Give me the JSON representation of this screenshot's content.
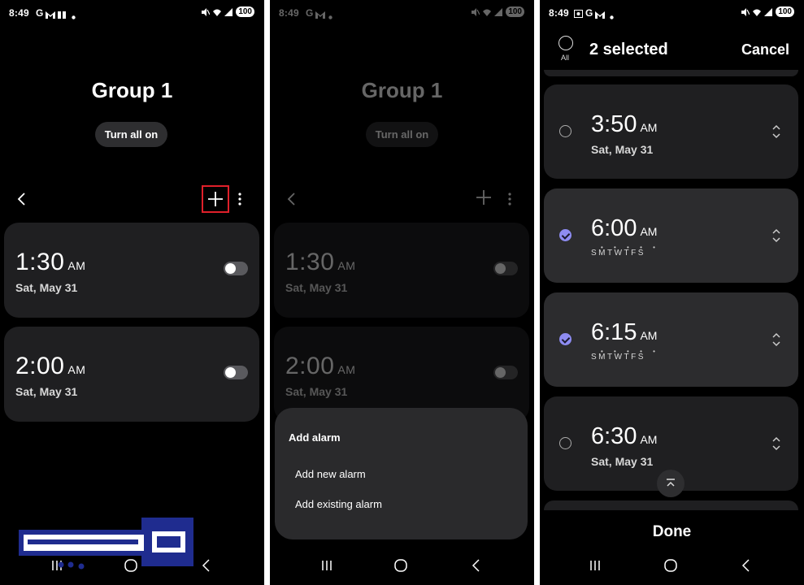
{
  "status_bar": [
    {
      "time": "8:49",
      "icons_text": "G",
      "battery": "100"
    },
    {
      "time": "8:49",
      "icons_text": "G",
      "battery": "100"
    },
    {
      "time": "8:49",
      "icons_text": "",
      "battery": "100"
    }
  ],
  "group_title": "Group 1",
  "turn_all_on_label": "Turn all on",
  "alarms_panel": [
    {
      "hour": "1:30",
      "ampm": "AM",
      "date": "Sat, May 31",
      "on": false
    },
    {
      "hour": "2:00",
      "ampm": "AM",
      "date": "Sat, May 31",
      "on": false
    }
  ],
  "add_alarm_sheet": {
    "title": "Add alarm",
    "options": [
      "Add new alarm",
      "Add existing alarm"
    ]
  },
  "selection": {
    "all_label": "All",
    "count_label": "2 selected",
    "cancel_label": "Cancel",
    "done_label": "Done",
    "alarms": [
      {
        "hour": "3:50",
        "ampm": "AM",
        "sub": "Sat, May 31",
        "selected": false,
        "repeat": false
      },
      {
        "hour": "6:00",
        "ampm": "AM",
        "sub": "SMTWTFS",
        "selected": true,
        "repeat": true
      },
      {
        "hour": "6:15",
        "ampm": "AM",
        "sub": "SMTWTFS",
        "selected": true,
        "repeat": true
      },
      {
        "hour": "6:30",
        "ampm": "AM",
        "sub": "Sat, May 31",
        "selected": false,
        "repeat": false
      }
    ]
  },
  "colors": {
    "background": "#000000",
    "card": "#1f1f21",
    "accent_check": "#8e8cf2",
    "highlight_box": "#e0202a",
    "watermark_blue": "#1f2c8f"
  },
  "watermark_text": "مهابتمه"
}
